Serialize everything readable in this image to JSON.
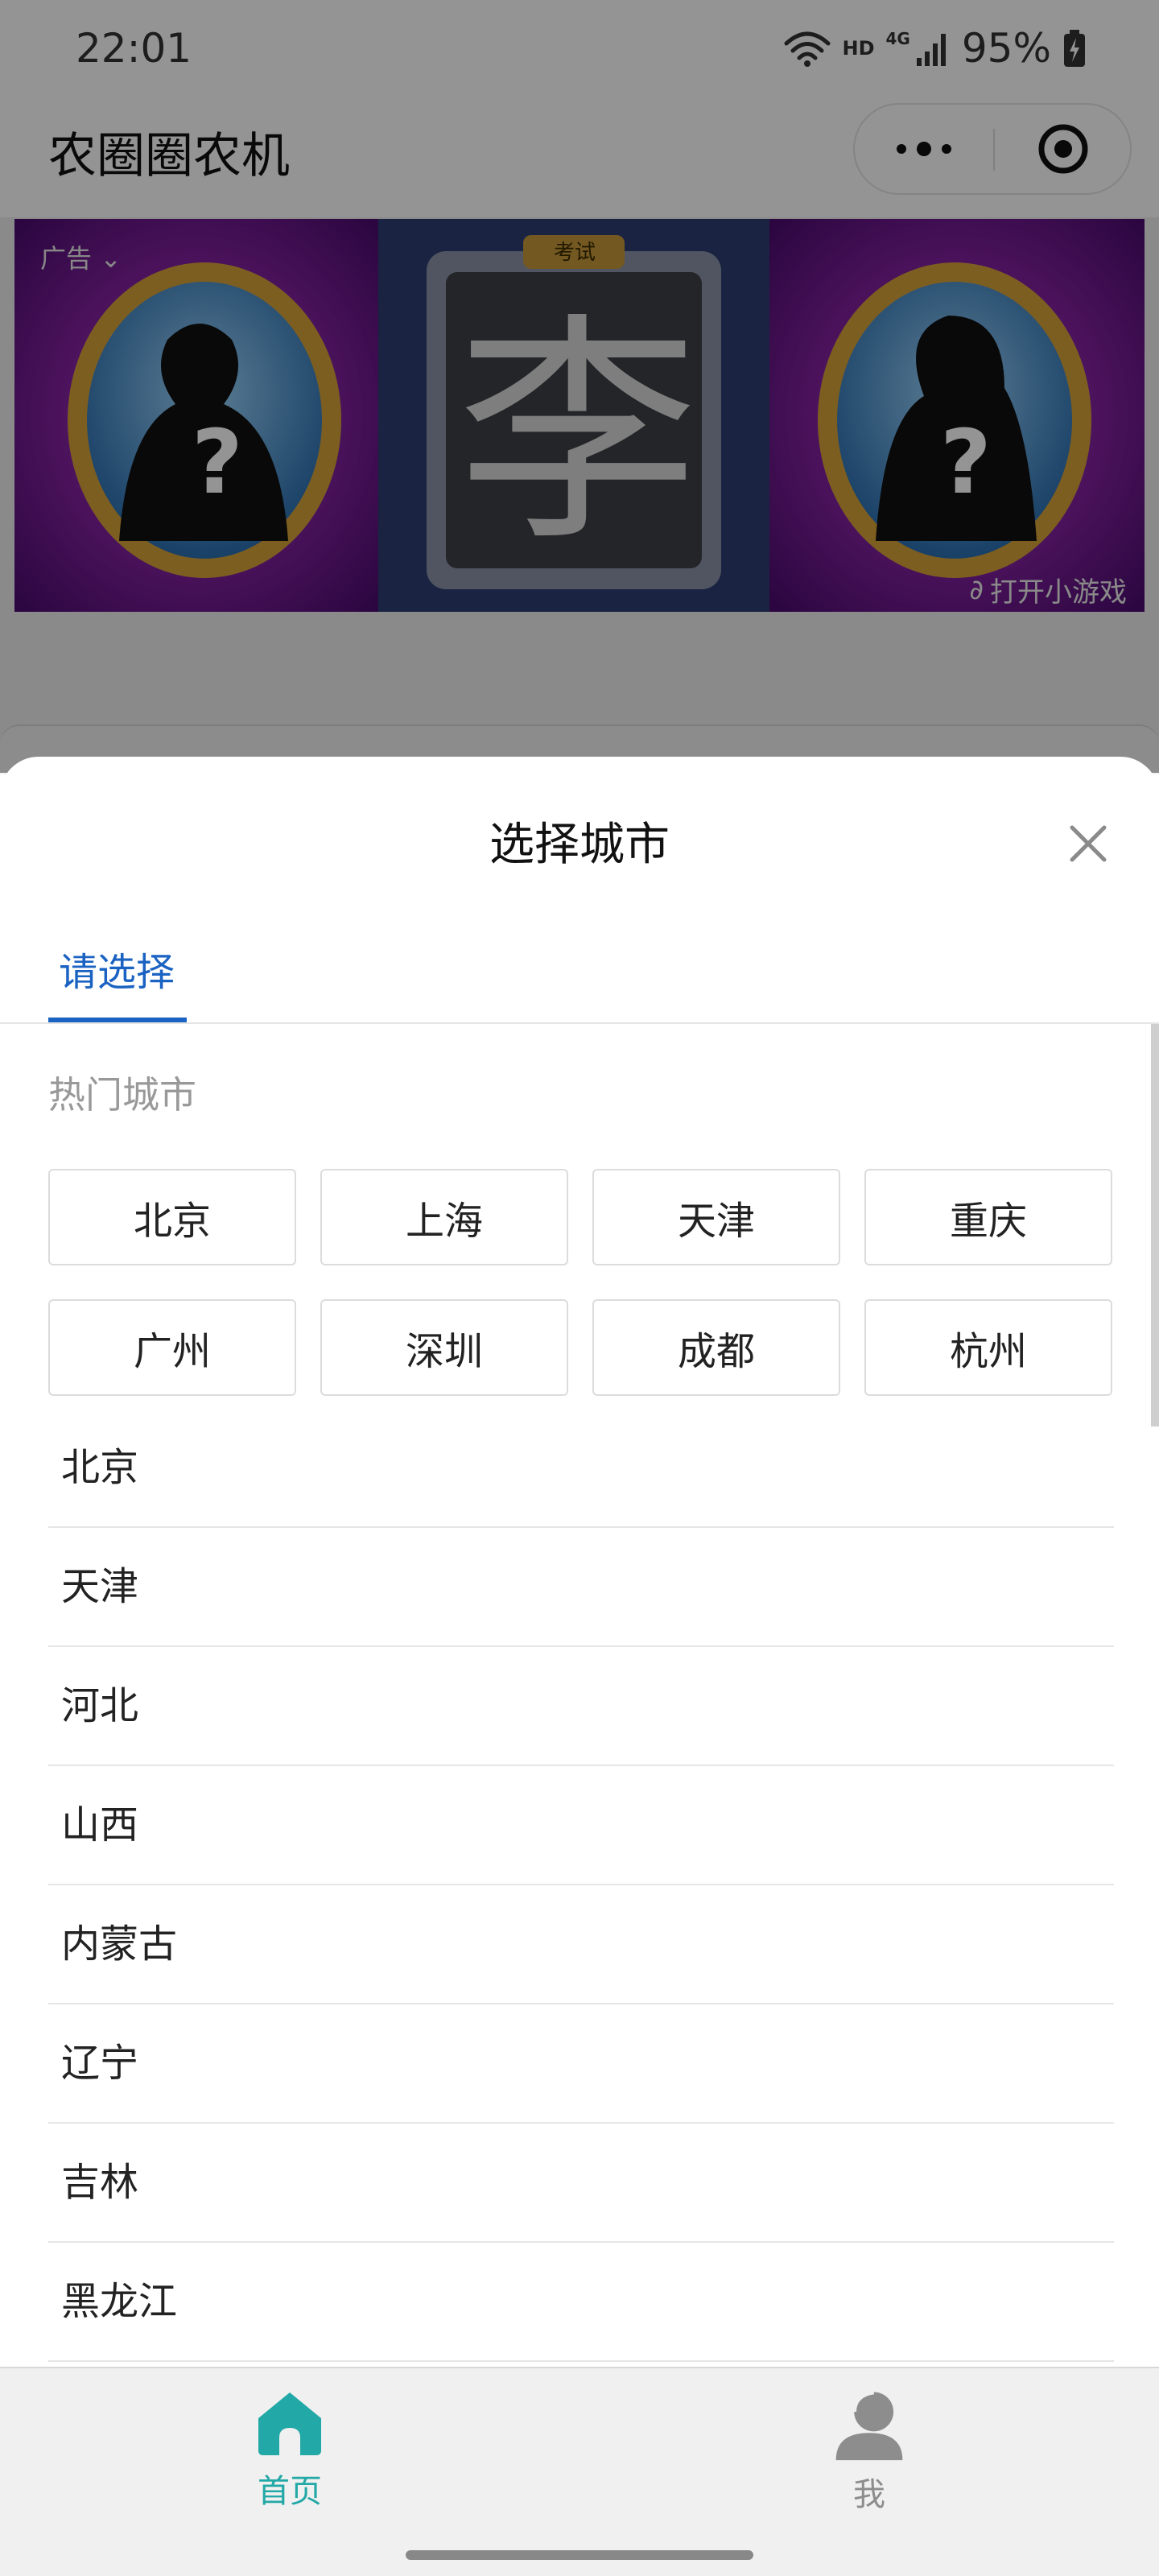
{
  "status_bar": {
    "time": "22:01",
    "hd_label": "HD",
    "network_label": "4G",
    "battery": "95%",
    "icons": [
      "wifi-icon",
      "signal-icon",
      "battery-charging-icon"
    ]
  },
  "title_bar": {
    "title": "农圈圈农机",
    "icons": [
      "more-dots-icon",
      "target-close-icon"
    ]
  },
  "ad": {
    "label": "广告",
    "center_character": "李",
    "badge": "考试",
    "open_game": "打开小游戏"
  },
  "sheet": {
    "title": "选择城市",
    "tab": "请选择",
    "hot_label": "热门城市",
    "hot_cities": [
      "北京",
      "上海",
      "天津",
      "重庆",
      "广州",
      "深圳",
      "成都",
      "杭州"
    ],
    "provinces": [
      "北京",
      "天津",
      "河北",
      "山西",
      "内蒙古",
      "辽宁",
      "吉林",
      "黑龙江"
    ]
  },
  "tabbar": {
    "home": "首页",
    "me": "我",
    "active_color": "#22a8a6",
    "inactive_color": "#8d8d8d"
  },
  "colors": {
    "accent_blue": "#1b63c2",
    "ad_purple": "#7a1a9e"
  }
}
